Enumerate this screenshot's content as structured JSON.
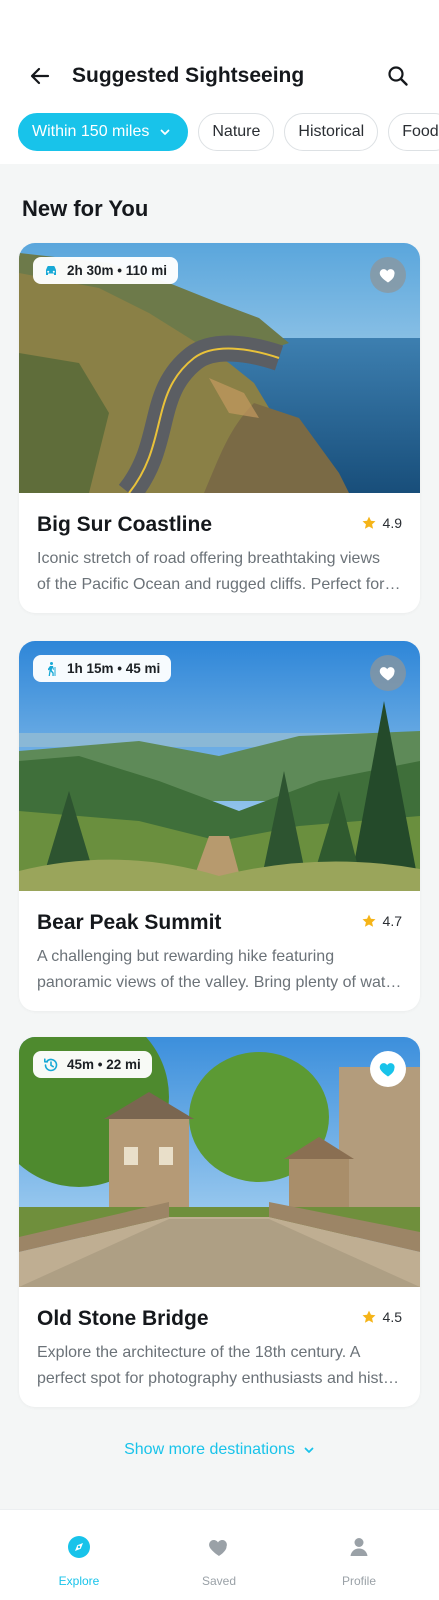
{
  "header": {
    "title": "Suggested Sightseeing"
  },
  "filters": [
    {
      "label": "Within 150 miles",
      "active": true
    },
    {
      "label": "Nature",
      "active": false
    },
    {
      "label": "Historical",
      "active": false
    },
    {
      "label": "Food",
      "active": false
    }
  ],
  "section": {
    "title": "New for You"
  },
  "cards": [
    {
      "name": "Big Sur Coastline",
      "rating": "4.9",
      "badge": "2h 30m • 110 mi",
      "badge_icon": "car-icon",
      "favorited": false,
      "desc_line1": "Iconic stretch of road offering breathtaking views",
      "desc_line2": "of the Pacific Ocean and rugged cliffs. Perfect for a scenic drive."
    },
    {
      "name": "Bear Peak Summit",
      "rating": "4.7",
      "badge": "1h 15m • 45 mi",
      "badge_icon": "hiker-icon",
      "favorited": false,
      "desc_line1": "A challenging but rewarding hike featuring",
      "desc_line2": "panoramic views of the valley. Bring plenty of water."
    },
    {
      "name": "Old Stone Bridge",
      "rating": "4.5",
      "badge": "45m • 22 mi",
      "badge_icon": "history-icon",
      "favorited": true,
      "desc_line1": "Explore the architecture of the 18th century. A",
      "desc_line2": "perfect spot for photography enthusiasts and history lovers."
    }
  ],
  "show_more": "Show more destinations",
  "nav": [
    {
      "label": "Explore",
      "icon": "compass-icon",
      "active": true
    },
    {
      "label": "Saved",
      "icon": "heart-icon",
      "active": false
    },
    {
      "label": "Profile",
      "icon": "person-icon",
      "active": false
    }
  ],
  "colors": {
    "accent": "#18c3ea",
    "star": "#f5b418",
    "text": "#15181c",
    "muted": "#6b7278"
  }
}
